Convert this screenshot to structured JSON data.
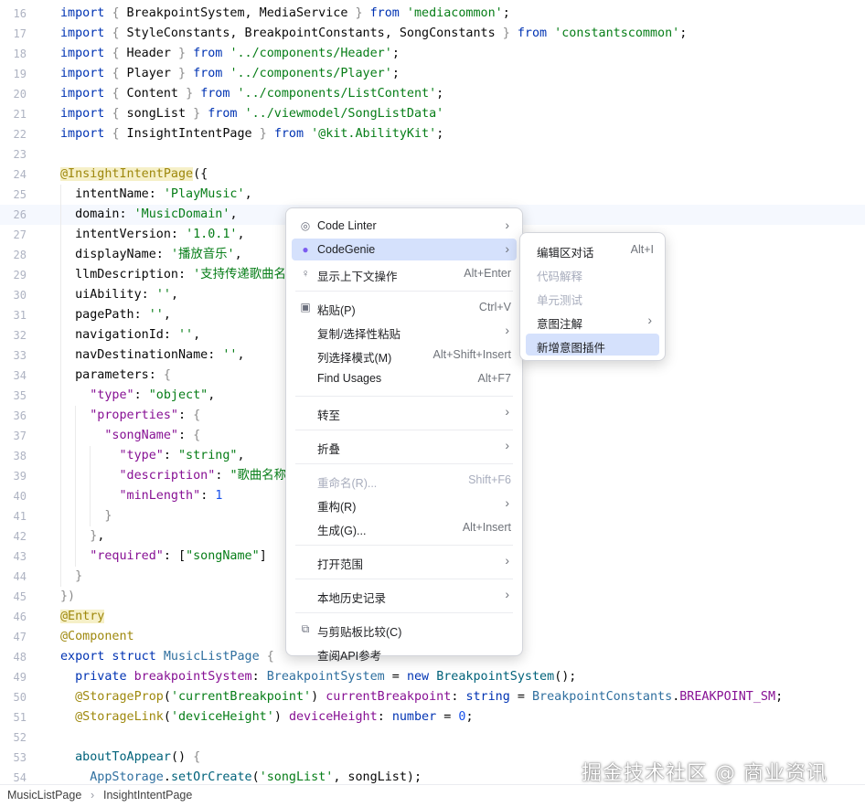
{
  "code_lines": [
    {
      "n": "16",
      "html": "<span class='k'>import</span> <span class='b'>{</span> BreakpointSystem, MediaService <span class='b'>}</span> <span class='k'>from</span> <span class='s'>'mediacommon'</span>;"
    },
    {
      "n": "17",
      "html": "<span class='k'>import</span> <span class='b'>{</span> StyleConstants, BreakpointConstants, SongConstants <span class='b'>}</span> <span class='k'>from</span> <span class='s'>'constantscommon'</span>;"
    },
    {
      "n": "18",
      "html": "<span class='k'>import</span> <span class='b'>{</span> Header <span class='b'>}</span> <span class='k'>from</span> <span class='s'>'../components/Header'</span>;"
    },
    {
      "n": "19",
      "html": "<span class='k'>import</span> <span class='b'>{</span> Player <span class='b'>}</span> <span class='k'>from</span> <span class='s'>'../components/Player'</span>;"
    },
    {
      "n": "20",
      "html": "<span class='k'>import</span> <span class='b'>{</span> Content <span class='b'>}</span> <span class='k'>from</span> <span class='s'>'../components/ListContent'</span>;"
    },
    {
      "n": "21",
      "html": "<span class='k'>import</span> <span class='b'>{</span> songList <span class='b'>}</span> <span class='k'>from</span> <span class='s'>'../viewmodel/SongListData'</span>"
    },
    {
      "n": "22",
      "html": "<span class='k'>import</span> <span class='b'>{</span> InsightIntentPage <span class='b'>}</span> <span class='k'>from</span> <span class='s'>'@kit.AbilityKit'</span>;"
    },
    {
      "n": "23",
      "html": ""
    },
    {
      "n": "24",
      "html": "<span class='a ah'>@InsightIntentPage</span>({"
    },
    {
      "n": "25",
      "html": "  intentName: <span class='s'>'PlayMusic'</span>,"
    },
    {
      "n": "26",
      "html": "  domain: <span class='s'>'MusicDomain'</span>,"
    },
    {
      "n": "27",
      "html": "  intentVersion: <span class='s'>'1.0.1'</span>,"
    },
    {
      "n": "28",
      "html": "  displayName: <span class='s'>'播放音乐'</span>,"
    },
    {
      "n": "29",
      "html": "  llmDescription: <span class='s'>'支持传递歌曲名称'</span>"
    },
    {
      "n": "30",
      "html": "  uiAbility: <span class='s'>''</span>,"
    },
    {
      "n": "31",
      "html": "  pagePath: <span class='s'>''</span>,"
    },
    {
      "n": "32",
      "html": "  navigationId: <span class='s'>''</span>,"
    },
    {
      "n": "33",
      "html": "  navDestinationName: <span class='s'>''</span>,"
    },
    {
      "n": "34",
      "html": "  parameters: <span class='b'>{</span>"
    },
    {
      "n": "35",
      "html": "    <span class='m'>\"type\"</span>: <span class='s'>\"object\"</span>,"
    },
    {
      "n": "36",
      "html": "    <span class='m'>\"properties\"</span>: <span class='b'>{</span>"
    },
    {
      "n": "37",
      "html": "      <span class='m'>\"songName\"</span>: <span class='b'>{</span>"
    },
    {
      "n": "38",
      "html": "        <span class='m'>\"type\"</span>: <span class='s'>\"string\"</span>,"
    },
    {
      "n": "39",
      "html": "        <span class='m'>\"description\"</span>: <span class='s'>\"歌曲名称\"</span>"
    },
    {
      "n": "40",
      "html": "        <span class='m'>\"minLength\"</span>: <span class='n'>1</span>"
    },
    {
      "n": "41",
      "html": "      <span class='b'>}</span>"
    },
    {
      "n": "42",
      "html": "    <span class='b'>}</span>,"
    },
    {
      "n": "43",
      "html": "    <span class='m'>\"required\"</span>: [<span class='s'>\"songName\"</span>]"
    },
    {
      "n": "44",
      "html": "  <span class='b'>}</span>"
    },
    {
      "n": "45",
      "html": "<span class='b'>})</span>"
    },
    {
      "n": "46",
      "html": "<span class='a ah'>@Entry</span>"
    },
    {
      "n": "47",
      "html": "<span class='a'>@Component</span>"
    },
    {
      "n": "48",
      "html": "<span class='k'>export struct</span> <span class='t'>MusicListPage</span> <span class='b'>{</span>"
    },
    {
      "n": "49",
      "html": "  <span class='k'>private</span> <span class='m'>breakpointSystem</span>: <span class='t'>BreakpointSystem</span> = <span class='k'>new</span> <span class='c'>BreakpointSystem</span>();"
    },
    {
      "n": "50",
      "html": "  <span class='a'>@StorageProp</span>(<span class='s'>'currentBreakpoint'</span>) <span class='m'>currentBreakpoint</span>: <span class='k'>string</span> = <span class='t'>BreakpointConstants</span>.<span class='m'>BREAKPOINT_SM</span>;"
    },
    {
      "n": "51",
      "html": "  <span class='a'>@StorageLink</span>(<span class='s'>'deviceHeight'</span>) <span class='m'>deviceHeight</span>: <span class='k'>number</span> = <span class='n'>0</span>;"
    },
    {
      "n": "52",
      "html": ""
    },
    {
      "n": "53",
      "html": "  <span class='fn'>aboutToAppear</span>() <span class='b'>{</span>"
    },
    {
      "n": "54",
      "html": "    <span class='t'>AppStorage</span>.<span class='fn'>setOrCreate</span>(<span class='s'>'songList'</span>, songList);"
    }
  ],
  "context_menu": {
    "items": [
      {
        "type": "item",
        "label": "Code Linter",
        "icon": "linter-icon",
        "submenu": true
      },
      {
        "type": "item",
        "label": "CodeGenie",
        "icon": "codegenie-icon",
        "submenu": true,
        "highlight": true
      },
      {
        "type": "item",
        "label": "显示上下文操作",
        "icon": "bulb-icon",
        "shortcut": "Alt+Enter"
      },
      {
        "type": "sep"
      },
      {
        "type": "item",
        "label": "粘贴(P)",
        "icon": "paste-icon",
        "shortcut": "Ctrl+V"
      },
      {
        "type": "item",
        "label": "复制/选择性粘贴",
        "submenu": true
      },
      {
        "type": "item",
        "label": "列选择模式(M)",
        "shortcut": "Alt+Shift+Insert"
      },
      {
        "type": "item",
        "label": "Find Usages",
        "shortcut": "Alt+F7"
      },
      {
        "type": "sep"
      },
      {
        "type": "item",
        "label": "转至",
        "submenu": true
      },
      {
        "type": "sep"
      },
      {
        "type": "item",
        "label": "折叠",
        "submenu": true
      },
      {
        "type": "sep"
      },
      {
        "type": "item",
        "label": "重命名(R)...",
        "shortcut": "Shift+F6",
        "disabled": true
      },
      {
        "type": "item",
        "label": "重构(R)",
        "submenu": true
      },
      {
        "type": "item",
        "label": "生成(G)...",
        "shortcut": "Alt+Insert"
      },
      {
        "type": "sep"
      },
      {
        "type": "item",
        "label": "打开范围",
        "submenu": true
      },
      {
        "type": "sep"
      },
      {
        "type": "item",
        "label": "本地历史记录",
        "submenu": true
      },
      {
        "type": "sep"
      },
      {
        "type": "item",
        "label": "与剪贴板比较(C)",
        "icon": "compare-icon"
      },
      {
        "type": "item",
        "label": "查阅API参考"
      }
    ]
  },
  "submenu": {
    "items": [
      {
        "label": "编辑区对话",
        "shortcut": "Alt+I"
      },
      {
        "label": "代码解释",
        "disabled": true
      },
      {
        "label": "单元测试",
        "disabled": true
      },
      {
        "label": "意图注解",
        "submenu": true
      },
      {
        "label": "新增意图插件",
        "highlight": true
      }
    ]
  },
  "breadcrumb": {
    "items": [
      "MusicListPage",
      "InsightIntentPage"
    ]
  },
  "watermark": "掘金技术社区 @ 商业资讯",
  "colors": {
    "keyword": "#0033b3",
    "string": "#067d17",
    "highlight": "#d5e1fc"
  }
}
